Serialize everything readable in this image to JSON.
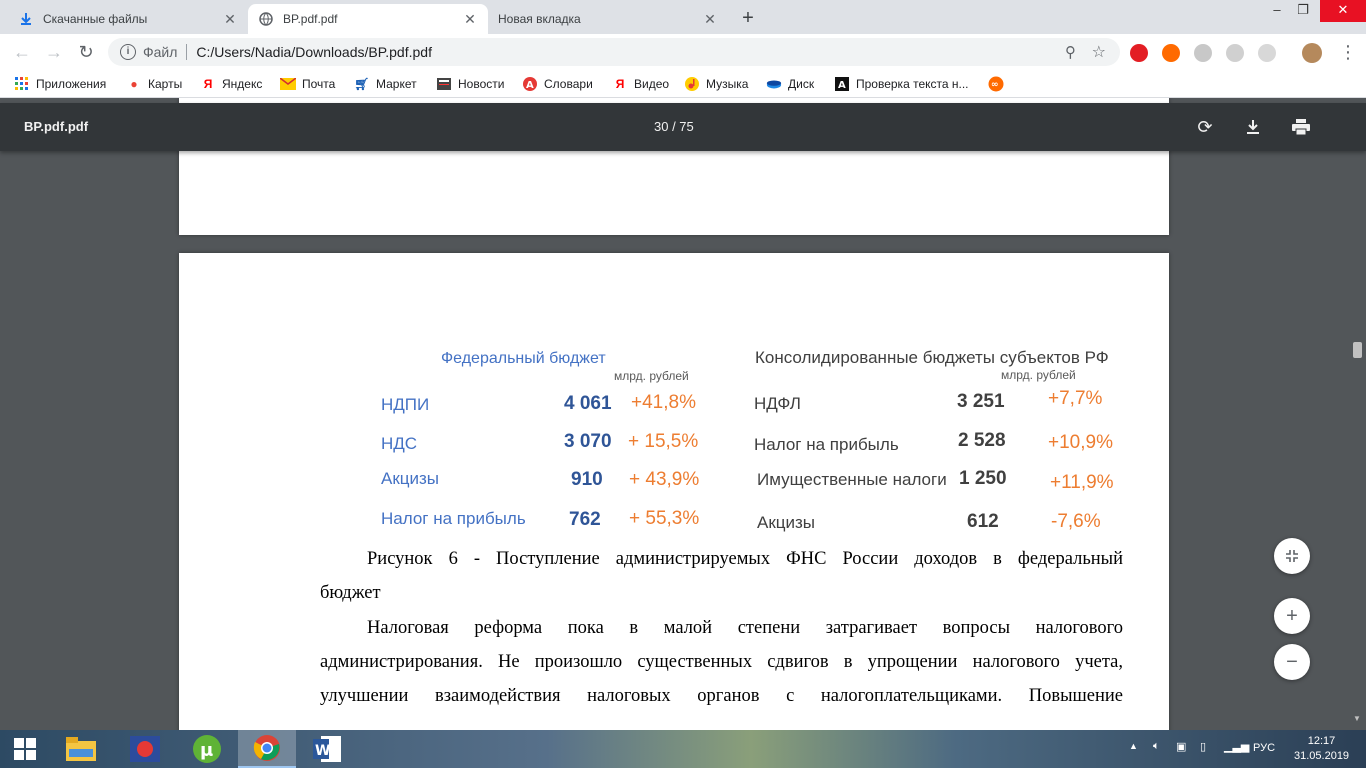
{
  "tabs": [
    {
      "title": "Скачанные файлы",
      "icon": "download-icon",
      "active": false
    },
    {
      "title": "BP.pdf.pdf",
      "icon": "globe-icon",
      "active": true
    },
    {
      "title": "Новая вкладка",
      "icon": "",
      "active": false
    }
  ],
  "toolbar": {
    "scheme": "Файл",
    "url": "C:/Users/Nadia/Downloads/BP.pdf.pdf"
  },
  "bookmarks": [
    {
      "label": "Приложения",
      "icon": "apps-grid-icon"
    },
    {
      "label": "Карты",
      "icon": "maps-pin-icon"
    },
    {
      "label": "Яндекс",
      "icon": "yandex-icon"
    },
    {
      "label": "Почта",
      "icon": "mail-icon"
    },
    {
      "label": "Маркет",
      "icon": "cart-icon"
    },
    {
      "label": "Новости",
      "icon": "news-icon"
    },
    {
      "label": "Словари",
      "icon": "dictionary-icon"
    },
    {
      "label": "Видео",
      "icon": "yandex-video-icon"
    },
    {
      "label": "Музыка",
      "icon": "music-icon"
    },
    {
      "label": "Диск",
      "icon": "disk-icon"
    },
    {
      "label": "Проверка текста н...",
      "icon": "text-check-icon"
    }
  ],
  "pdf": {
    "filename": "BP.pdf.pdf",
    "page_indicator": "30 / 75"
  },
  "figure": {
    "left_title": "Федеральный бюджет",
    "left_unit": "млрд. рублей",
    "left_rows": [
      {
        "name": "НДПИ",
        "value": "4 061",
        "change": "+41,8%"
      },
      {
        "name": "НДС",
        "value": "3 070",
        "change": "+ 15,5%"
      },
      {
        "name": "Акцизы",
        "value": "910",
        "change": "+ 43,9%"
      },
      {
        "name": "Налог на прибыль",
        "value": "762",
        "change": "+ 55,3%"
      }
    ],
    "right_title": "Консолидированные бюджеты субъектов РФ",
    "right_unit": "млрд. рублей",
    "right_rows": [
      {
        "name": "НДФЛ",
        "value": "3 251",
        "change": "+7,7%"
      },
      {
        "name": "Налог на прибыль",
        "value": "2 528",
        "change": "+10,9%"
      },
      {
        "name": "Имущественные налоги",
        "value": "1 250",
        "change": "+11,9%"
      },
      {
        "name": "Акцизы",
        "value": "612",
        "change": "-7,6%"
      }
    ]
  },
  "document": {
    "caption_line1": "Рисунок 6 - Поступление администрируемых ФНС России доходов в федеральный",
    "caption_line2": "бюджет",
    "para_line1": "Налоговая реформа пока в малой степени затрагивает вопросы налогового",
    "para_line2": "администрирования. Не произошло существенных сдвигов в упрощении налогового учета,",
    "para_line3": "улучшении взаимодействия налоговых органов с налогоплательщиками. Повышение"
  },
  "taskbar": {
    "language": "РУС",
    "time": "12:17",
    "date": "31.05.2019"
  }
}
